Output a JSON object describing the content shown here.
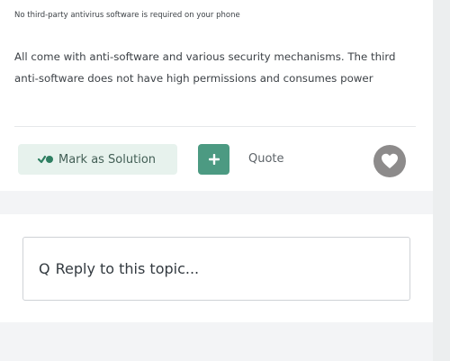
{
  "post": {
    "title": "No third-party antivirus software is required on your phone",
    "body": "All come with anti-software and various security mechanisms. The third anti-software does not have high permissions and consumes power"
  },
  "actions": {
    "mark_solution_label": "Mark as Solution",
    "plus_symbol": "+",
    "quote_label": "Quote",
    "heart_icon": "heart-icon"
  },
  "reply": {
    "search_glyph": "Q",
    "placeholder": "Reply to this topic..."
  },
  "colors": {
    "solution_background": "#e7f2ed",
    "accent_green": "#4c9a82",
    "heart_gray": "#8d8b8b"
  }
}
